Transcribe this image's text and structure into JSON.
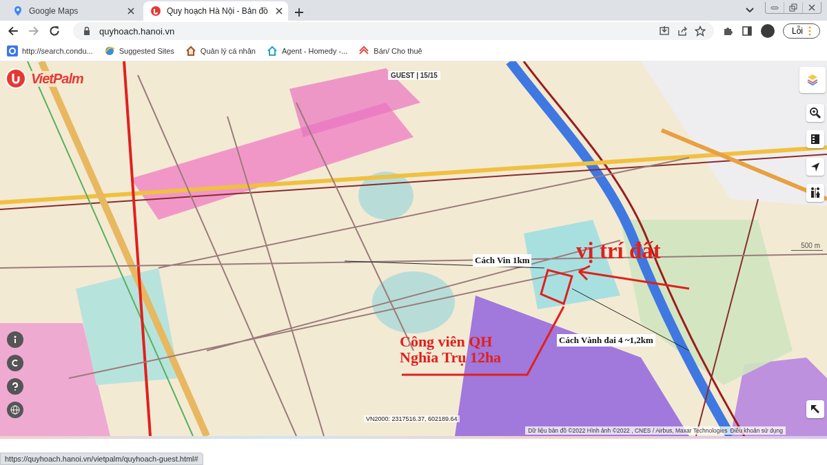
{
  "tabs": [
    {
      "title": "Google Maps",
      "selected": false
    },
    {
      "title": "Quy hoạch Hà Nội - Bản đồ",
      "selected": true
    }
  ],
  "address_bar": {
    "url": "quyhoach.hanoi.vn"
  },
  "profile_button": {
    "label": "Lỗi"
  },
  "bookmarks": [
    {
      "label": "http://search.condu..."
    },
    {
      "label": "Suggested Sites"
    },
    {
      "label": "Quản lý cá nhân"
    },
    {
      "label": "Agent - Homedy -..."
    },
    {
      "label": "Bán/ Cho thuê"
    }
  ],
  "map": {
    "logo": "VietPalm",
    "session_badge": "GUEST | 15/15",
    "coordinates": "VN2000: 2317516.37, 602189.64",
    "scale": "500 m",
    "attribution": "Dữ liệu bản đồ ©2022 Hình ảnh ©2022 , CNES / Airbus, Maxar Technologies",
    "terms_link": "Điều khoản sử dụng",
    "annotations": [
      {
        "kind": "note",
        "text": "Cách Vin 1km"
      },
      {
        "kind": "label",
        "text": "vị trí đất"
      },
      {
        "kind": "label",
        "text": "Công viên QH Nghĩa Trụ 12ha"
      },
      {
        "kind": "note",
        "text": "Cách Vành đai 4 ~1,2km"
      }
    ]
  },
  "status_bar": {
    "url": "https://quyhoach.hanoi.vn/vietpalm/quyhoach-guest.html#"
  }
}
